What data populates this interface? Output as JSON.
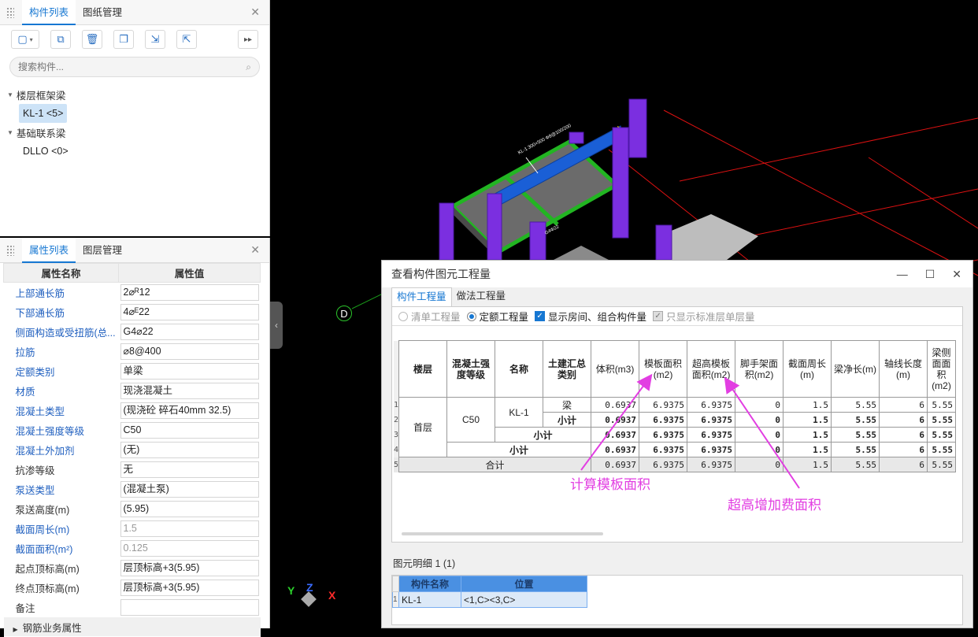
{
  "component_panel": {
    "tabs": [
      "构件列表",
      "图纸管理"
    ],
    "search_placeholder": "搜索构件...",
    "tree": [
      {
        "group": "楼层框架梁",
        "items": [
          {
            "label": "KL-1 <5>",
            "selected": true
          }
        ]
      },
      {
        "group": "基础联系梁",
        "items": [
          {
            "label": "DLLO <0>",
            "selected": false
          }
        ]
      }
    ],
    "toolbar_icons": [
      "new-icon",
      "copy-icon",
      "delete-icon",
      "copy-layer-icon",
      "import-icon",
      "export-icon",
      "more-icon"
    ]
  },
  "property_panel": {
    "tabs": [
      "属性列表",
      "图层管理"
    ],
    "col_name": "属性名称",
    "col_value": "属性值",
    "rows": [
      {
        "name": "上部通长筋",
        "value": "2⌀ᴿ12"
      },
      {
        "name": "下部通长筋",
        "value": "4⌀ᴱ22"
      },
      {
        "name": "侧面构造或受扭筋(总...",
        "value": "G4⌀22"
      },
      {
        "name": "拉筋",
        "value": "⌀8@400"
      },
      {
        "name": "定额类别",
        "value": "单梁"
      },
      {
        "name": "材质",
        "value": "现浇混凝土"
      },
      {
        "name": "混凝土类型",
        "value": "(现浇砼 碎石40mm 32.5)"
      },
      {
        "name": "混凝土强度等级",
        "value": "C50"
      },
      {
        "name": "混凝土外加剂",
        "value": "(无)"
      },
      {
        "name": "抗渗等级",
        "value": "无"
      },
      {
        "name": "泵送类型",
        "value": "(混凝土泵)"
      },
      {
        "name": "泵送高度(m)",
        "value": "(5.95)"
      },
      {
        "name": "截面周长(m)",
        "value": "1.5"
      },
      {
        "name": "截面面积(m²)",
        "value": "0.125"
      },
      {
        "name": "起点顶标高(m)",
        "value": "层顶标高+3(5.95)"
      },
      {
        "name": "终点顶标高(m)",
        "value": "层顶标高+3(5.95)"
      },
      {
        "name": "备注",
        "value": ""
      }
    ],
    "section": "钢筋业务属性"
  },
  "viewport": {
    "axis_label": "D",
    "axes": {
      "x": "X",
      "y": "Y",
      "z": "Z"
    }
  },
  "dialog": {
    "title": "查看构件图元工程量",
    "tabs": [
      "构件工程量",
      "做法工程量"
    ],
    "options": [
      {
        "label": "清单工程量",
        "type": "radio",
        "checked": false,
        "disabled": true
      },
      {
        "label": "定额工程量",
        "type": "radio",
        "checked": true,
        "disabled": false
      },
      {
        "label": "显示房间、组合构件量",
        "type": "checkbox",
        "checked": true,
        "disabled": false
      },
      {
        "label": "只显示标准层单层量",
        "type": "checkbox",
        "checked": true,
        "disabled": true
      }
    ],
    "table": {
      "headers": [
        "楼层",
        "混凝土强度等级",
        "名称",
        "土建汇总类别",
        "体积(m3)",
        "模板面积(m2)",
        "超高模板面积(m2)",
        "脚手架面积(m2)",
        "截面周长(m)",
        "梁净长(m)",
        "轴线长度(m)",
        "梁侧面面积(m2)"
      ],
      "floor": "首层",
      "grade": "C50",
      "name": "KL-1",
      "category": "梁",
      "subtotal_label": "小计",
      "total_label": "合计",
      "row_numbers": [
        "1",
        "2",
        "3",
        "4",
        "5"
      ],
      "values": [
        "0.6937",
        "6.9375",
        "6.9375",
        "0",
        "1.5",
        "5.55",
        "6",
        "5.55"
      ]
    },
    "detail_label": "图元明细  1 (1)",
    "detail_table": {
      "headers": [
        "构件名称",
        "位置"
      ],
      "rows": [
        {
          "n": "1",
          "name": "KL-1",
          "pos": "<1,C><3,C>"
        }
      ]
    }
  },
  "annotations": {
    "formwork": "计算模板面积",
    "overheight": "超高增加费面积"
  },
  "colors": {
    "accent": "#1677d2",
    "annotation": "#e23ee2",
    "beam": "#1a5fd6",
    "column": "#7b2fe0",
    "slab_edge": "#22b522",
    "grid": "#d11"
  }
}
